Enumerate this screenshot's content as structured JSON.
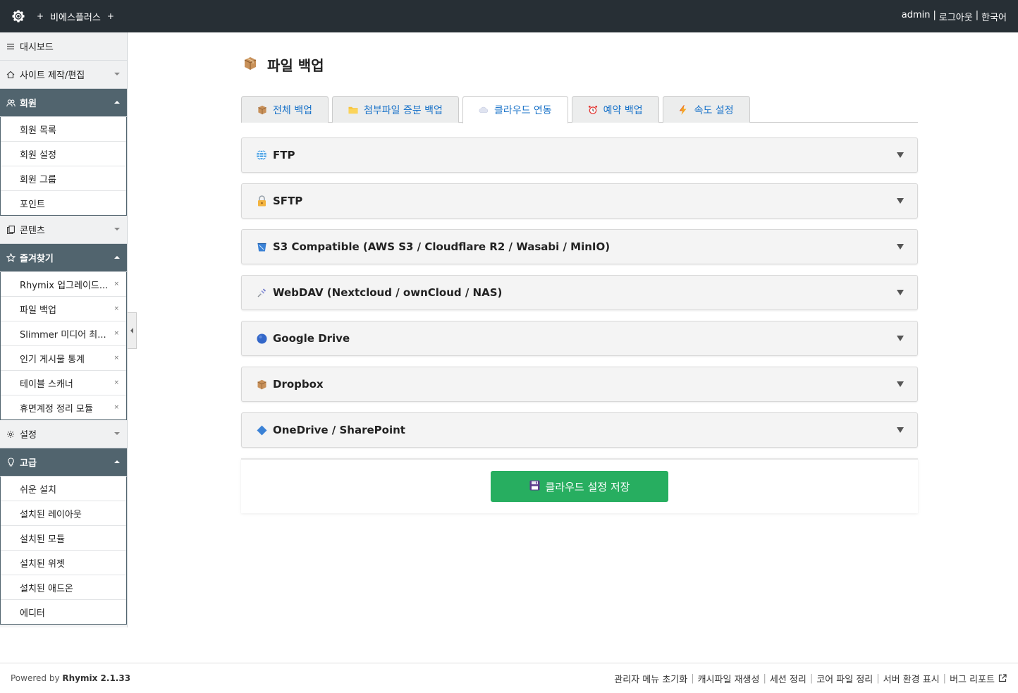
{
  "topbar": {
    "site_name": "비에스플러스",
    "plus_left": "+",
    "plus_right": "+",
    "user": "admin",
    "sep": "|",
    "logout": "로그아웃",
    "language": "한국어"
  },
  "sidebar": {
    "dashboard": "대시보드",
    "site_edit": "사이트 제작/편집",
    "member": {
      "label": "회원",
      "items": [
        "회원 목록",
        "회원 설정",
        "회원 그룹",
        "포인트"
      ]
    },
    "content": "콘텐츠",
    "favorites": {
      "label": "즐겨찾기",
      "items": [
        "Rhymix 업그레이드...",
        "파일 백업",
        "Slimmer 미디어 최...",
        "인기 게시물 통계",
        "테이블 스캐너",
        "휴면계정 정리 모듈"
      ],
      "remove_symbol": "×"
    },
    "settings": "설정",
    "advanced": {
      "label": "고급",
      "items": [
        "쉬운 설치",
        "설치된 레이아웃",
        "설치된 모듈",
        "설치된 위젯",
        "설치된 애드온",
        "에디터"
      ]
    }
  },
  "main": {
    "title": "파일 백업",
    "tabs": [
      {
        "label": "전체 백업",
        "icon": "box-icon"
      },
      {
        "label": "첨부파일 증분 백업",
        "icon": "folder-icon"
      },
      {
        "label": "클라우드 연동",
        "icon": "cloud-icon"
      },
      {
        "label": "예약 백업",
        "icon": "alarm-clock-icon"
      },
      {
        "label": "속도 설정",
        "icon": "lightning-icon"
      }
    ],
    "active_tab": 2,
    "panels": [
      {
        "label": "FTP",
        "icon": "globe-icon"
      },
      {
        "label": "SFTP",
        "icon": "lock-icon"
      },
      {
        "label": "S3 Compatible (AWS S3 / Cloudflare R2 / Wasabi / MinIO)",
        "icon": "bucket-icon"
      },
      {
        "label": "WebDAV (Nextcloud / ownCloud / NAS)",
        "icon": "satellite-icon"
      },
      {
        "label": "Google Drive",
        "icon": "blue-circle-icon"
      },
      {
        "label": "Dropbox",
        "icon": "box-icon"
      },
      {
        "label": "OneDrive / SharePoint",
        "icon": "blue-diamond-icon"
      }
    ],
    "save_button": "클라우드 설정 저장"
  },
  "footer": {
    "powered_prefix": "Powered by",
    "powered_brand": "Rhymix 2.1.33",
    "links": [
      "관리자 메뉴 초기화",
      "캐시파일 재생성",
      "세션 정리",
      "코어 파일 정리",
      "서버 환경 표시",
      "버그 리포트"
    ],
    "sep": "|"
  },
  "colors": {
    "topbar": "#272f35",
    "sidebar_active": "#51646e",
    "tab_text": "#1a73c9",
    "save_button": "#27ae60"
  }
}
